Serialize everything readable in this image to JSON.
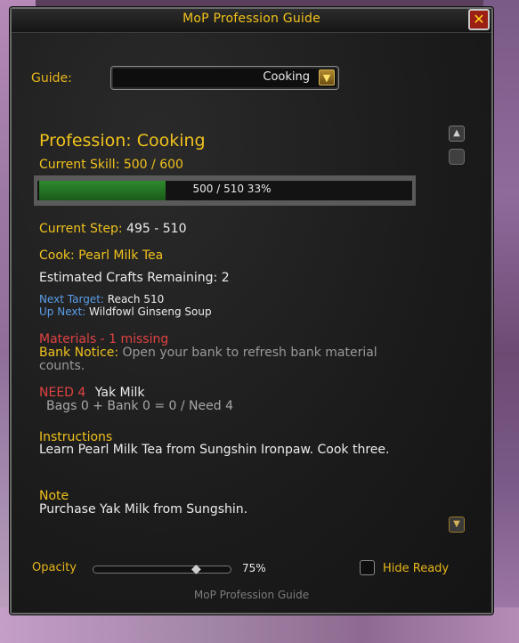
{
  "window": {
    "title": "MoP Profession Guide",
    "close_glyph": "✕"
  },
  "guide": {
    "label": "Guide:",
    "selected": "Cooking",
    "arrow_icon": "dropdown-arrow-icon"
  },
  "profession": {
    "heading": "Profession: Cooking",
    "current_skill": "Current Skill: 500 / 600"
  },
  "progress": {
    "text": "500 / 510   33%",
    "fraction": 0.33
  },
  "step": {
    "label": "Current Step:",
    "value": "495 - 510"
  },
  "cook": "Cook: Pearl Milk Tea",
  "estimated": "Estimated Crafts Remaining: 2",
  "next_target": {
    "label": "Next Target:",
    "value": "Reach 510"
  },
  "up_next": {
    "label": "Up Next:",
    "value": "Wildfowl Ginseng Soup"
  },
  "materials": {
    "header": "Materials - 1 missing",
    "bank_notice_label": "Bank Notice:",
    "bank_notice_text": "Open your bank to refresh bank material counts.",
    "need_label": "NEED 4",
    "need_item": "Yak Milk",
    "counts": "Bags 0 + Bank 0 = 0 / Need 4"
  },
  "instructions": {
    "header": "Instructions",
    "text": "Learn Pearl Milk Tea from Sungshin Ironpaw. Cook three."
  },
  "note": {
    "header": "Note",
    "text": "Purchase Yak Milk from Sungshin."
  },
  "opacity": {
    "label": "Opacity",
    "value": "75%",
    "fraction": 0.75
  },
  "hide_ready": {
    "label": "Hide Ready",
    "checked": false
  },
  "footer": "MoP Profession Guide",
  "colors": {
    "gold": "#f0c21d",
    "red": "#e04343",
    "blue": "#5a9ee8",
    "bar_green": "#2e8a2e"
  }
}
